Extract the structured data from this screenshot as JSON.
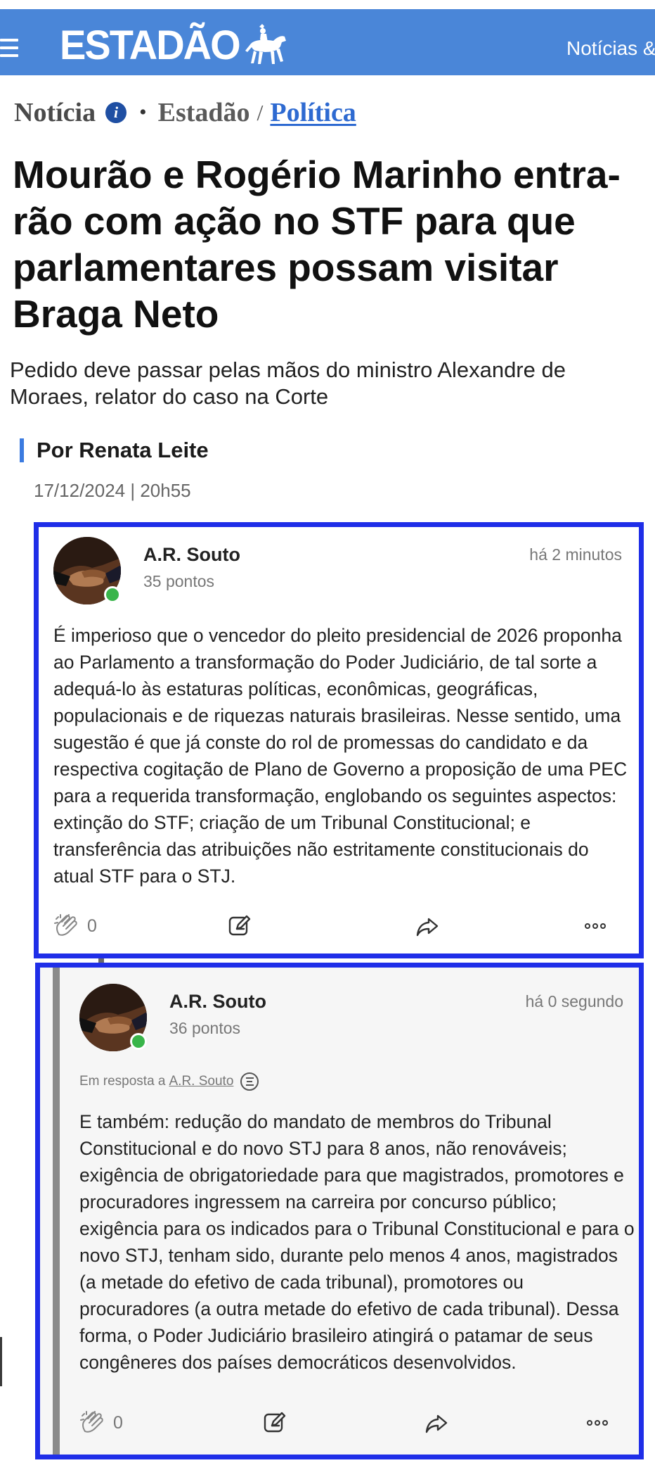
{
  "header": {
    "logo_text": "ESTADÃO",
    "nav_partial": "Notícias &",
    "colors": {
      "bar": "#4a86d8",
      "text": "#ffffff"
    }
  },
  "breadcrumb": {
    "type_label": "Notícia",
    "source": "Estadão",
    "separator": "/",
    "section": "Política"
  },
  "article": {
    "headline": "Mourão e Rogério Marinho entra-rão com ação no STF para que parlamentares possam visitar Braga Neto",
    "subheadline": "Pedido deve passar pelas mãos do ministro Alexandre de Moraes, relator do caso na Corte",
    "byline": "Por Renata Leite",
    "date": "17/12/2024 | 20h55"
  },
  "comments": [
    {
      "author": "A.R. Souto",
      "points": "35 pontos",
      "time": "há 2 minutos",
      "body": "É imperioso que o vencedor do pleito presidencial de 2026 proponha ao Parlamento a transformação do Poder Judiciário, de tal sorte a adequá-lo às estaturas políticas, econômicas, geográficas, populacionais e de riquezas naturais brasileiras. Nesse sentido, uma sugestão é que já conste do rol de promessas do candidato e da respectiva cogitação de Plano de Governo a proposição de uma PEC para a requerida transformação, englobando os seguintes aspectos: extinção do STF; criação de um Tribunal Constitucional; e transferência das atribuições não estritamente constitucionais do atual STF para o STJ.",
      "likes": "0"
    },
    {
      "author": "A.R. Souto",
      "points": "36 pontos",
      "time": "há 0 segundo",
      "reply_prefix": "Em resposta a",
      "reply_to": "A.R. Souto",
      "body": "E também: redução do mandato de membros do Tribunal Constitucional e do novo STJ para 8 anos, não renováveis; exigência de obrigatoriedade para que magistrados, promotores e procuradores ingressem na carreira por concurso público; exigência para os indicados para o Tribunal Constitucional e para o novo STJ, tenham sido, durante pelo menos 4 anos, magistrados (a metade do efetivo de cada tribunal), promotores ou procuradores (a outra metade do efetivo de cada tribunal). Dessa forma, o Poder Judiciário brasileiro atingirá o patamar de seus congêneres dos países democráticos desenvolvidos.",
      "likes": "0"
    }
  ],
  "icons": {
    "menu": "hamburger-icon",
    "info": "info-icon",
    "like": "clap-icon",
    "reply": "edit-icon",
    "share": "share-arrow-icon",
    "more": "more-dots-icon",
    "reply_indicator": "reply-thread-icon"
  },
  "colors": {
    "highlight_border": "#1f2ee8",
    "online": "#39b54a",
    "link": "#2e6ad1"
  }
}
